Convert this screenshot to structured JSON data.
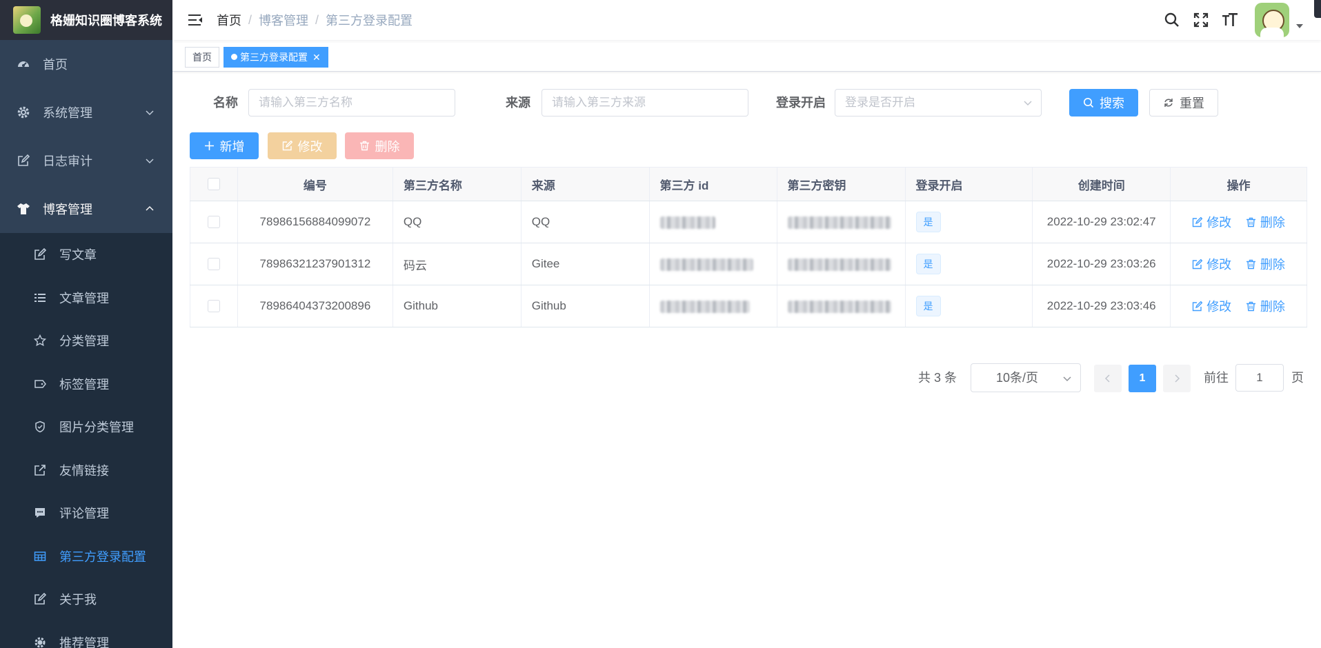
{
  "app": {
    "title": "格姗知识圈博客系统"
  },
  "sidebar": {
    "items": [
      {
        "label": "首页",
        "icon": "dashboard-icon"
      },
      {
        "label": "系统管理",
        "icon": "gear-icon"
      },
      {
        "label": "日志审计",
        "icon": "edit-icon"
      },
      {
        "label": "博客管理",
        "icon": "shirt-icon"
      }
    ],
    "sub_items": [
      {
        "label": "写文章",
        "icon": "edit-icon"
      },
      {
        "label": "文章管理",
        "icon": "list-icon"
      },
      {
        "label": "分类管理",
        "icon": "star-icon"
      },
      {
        "label": "标签管理",
        "icon": "tag-icon"
      },
      {
        "label": "图片分类管理",
        "icon": "shield-icon"
      },
      {
        "label": "友情链接",
        "icon": "external-link-icon"
      },
      {
        "label": "评论管理",
        "icon": "comment-icon"
      },
      {
        "label": "第三方登录配置",
        "icon": "table-icon"
      },
      {
        "label": "关于我",
        "icon": "edit-icon"
      },
      {
        "label": "推荐管理",
        "icon": "gear-icon"
      }
    ]
  },
  "breadcrumb": {
    "items": [
      "首页",
      "博客管理",
      "第三方登录配置"
    ],
    "separator": "/"
  },
  "tags": {
    "home": "首页",
    "current": "第三方登录配置"
  },
  "search": {
    "name_label": "名称",
    "name_placeholder": "请输入第三方名称",
    "source_label": "来源",
    "source_placeholder": "请输入第三方来源",
    "open_label": "登录开启",
    "open_placeholder": "登录是否开启",
    "search_button": "搜索",
    "reset_button": "重置"
  },
  "toolbar": {
    "add": "新增",
    "edit": "修改",
    "delete": "删除"
  },
  "table": {
    "headers": [
      "编号",
      "第三方名称",
      "来源",
      "第三方 id",
      "第三方密钥",
      "登录开启",
      "创建时间",
      "操作"
    ],
    "rows": [
      {
        "id": "78986156884099072",
        "name": "QQ",
        "source": "QQ",
        "open": "是",
        "created": "2022-10-29 23:02:47"
      },
      {
        "id": "78986321237901312",
        "name": "码云",
        "source": "Gitee",
        "open": "是",
        "created": "2022-10-29 23:03:26"
      },
      {
        "id": "78986404373200896",
        "name": "Github",
        "source": "Github",
        "open": "是",
        "created": "2022-10-29 23:03:46"
      }
    ],
    "row_edit": "修改",
    "row_delete": "删除"
  },
  "pagination": {
    "total": "共 3 条",
    "page_size": "10条/页",
    "current": "1",
    "goto_label": "前往",
    "goto_value": "1",
    "page_suffix": "页"
  },
  "colors": {
    "primary": "#409eff",
    "sidebar": "#304156",
    "warning_light": "#f3d19e",
    "danger_light": "#fab6b6"
  }
}
